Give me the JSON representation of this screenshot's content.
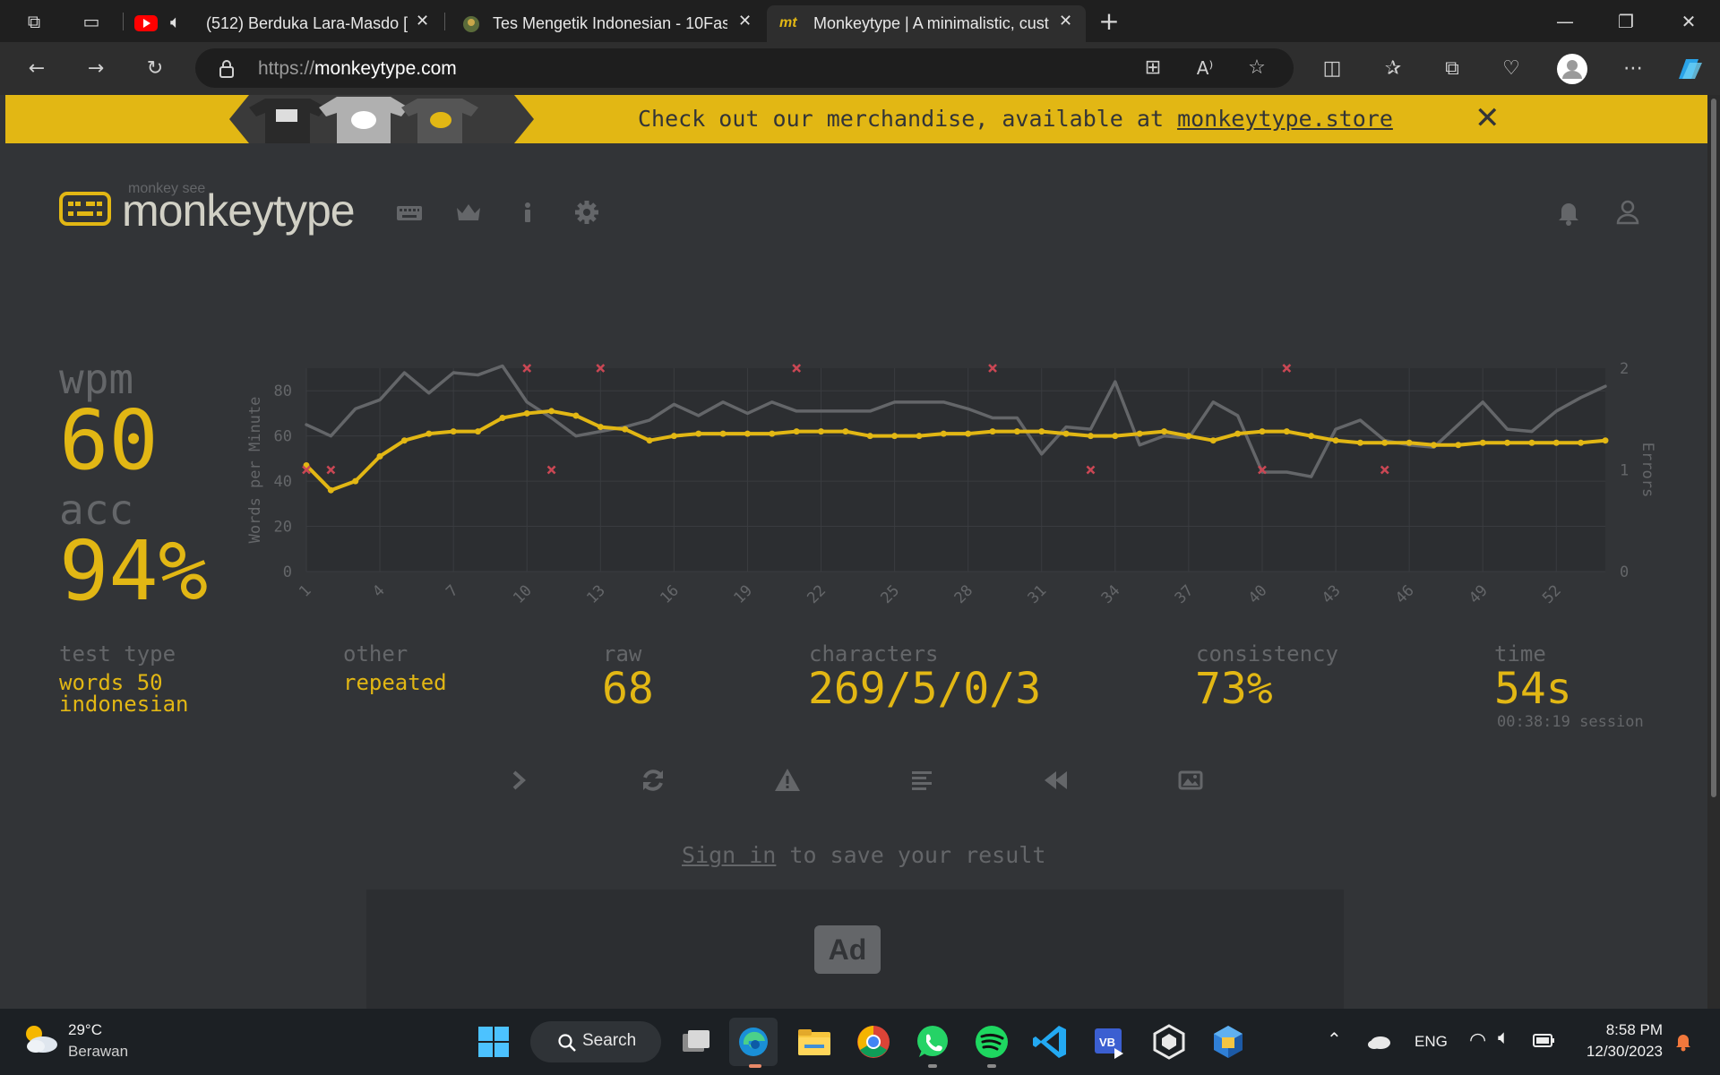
{
  "browser": {
    "tabs": [
      {
        "title": "(512) Berduka Lara-Masdo [",
        "close": "✕"
      },
      {
        "title": "Tes Mengetik Indonesian - 10Fast",
        "close": "✕"
      },
      {
        "title": "Monkeytype | A minimalistic, cust",
        "close": "✕"
      }
    ],
    "active_tab_favicon": "mt",
    "new_tab": "+",
    "window_controls": {
      "minimize": "—",
      "restore": "❐",
      "close": "✕"
    },
    "url_prefix": "https://",
    "url_domain": "monkeytype.com"
  },
  "banner": {
    "text": "Check out our merchandise, available at ",
    "link": "monkeytype.store",
    "close": "✕"
  },
  "nav": {
    "logo_top": "monkey see",
    "logo_text": "monkeytype",
    "icons": [
      "keyboard-icon",
      "crown-icon",
      "info-icon",
      "gear-icon",
      "bell-icon",
      "user-icon"
    ]
  },
  "result": {
    "wpm_label": "wpm",
    "wpm": "60",
    "acc_label": "acc",
    "acc": "94%",
    "test_type_label": "test type",
    "test_type_line1": "words 50",
    "test_type_line2": "indonesian",
    "other_label": "other",
    "other_value": "repeated",
    "raw_label": "raw",
    "raw_value": "68",
    "characters_label": "characters",
    "characters_value": "269/5/0/3",
    "consistency_label": "consistency",
    "consistency_value": "73%",
    "time_label": "time",
    "time_value": "54s",
    "session": "00:38:19 session"
  },
  "chart_data": {
    "type": "line",
    "ylabel": "Words per Minute",
    "y2label": "Errors",
    "ylim": [
      0,
      90
    ],
    "y2lim": [
      0,
      2
    ],
    "yticks": [
      "0",
      "20",
      "40",
      "60",
      "80"
    ],
    "y2ticks": [
      "0",
      "1",
      "2"
    ],
    "xticks": [
      "1",
      "4",
      "7",
      "10",
      "13",
      "16",
      "19",
      "22",
      "25",
      "28",
      "31",
      "34",
      "37",
      "40",
      "43",
      "46",
      "49",
      "52"
    ],
    "x": [
      1,
      2,
      3,
      4,
      5,
      6,
      7,
      8,
      9,
      10,
      11,
      12,
      13,
      14,
      15,
      16,
      17,
      18,
      19,
      20,
      21,
      22,
      23,
      24,
      25,
      26,
      27,
      28,
      29,
      30,
      31,
      32,
      33,
      34,
      35,
      36,
      37,
      38,
      39,
      40,
      41,
      42,
      43,
      44,
      45,
      46,
      47,
      48,
      49,
      50,
      51,
      52,
      53,
      54
    ],
    "series": [
      {
        "name": "raw",
        "color": "#646669",
        "values": [
          65,
          60,
          72,
          76,
          88,
          79,
          88,
          87,
          91,
          75,
          68,
          60,
          62,
          64,
          67,
          74,
          69,
          75,
          70,
          75,
          71,
          71,
          71,
          71,
          75,
          75,
          75,
          72,
          68,
          68,
          52,
          64,
          63,
          84,
          56,
          60,
          59,
          75,
          69,
          44,
          44,
          42,
          63,
          67,
          58,
          56,
          55,
          65,
          75,
          63,
          62,
          71,
          77,
          82,
          73
        ]
      },
      {
        "name": "wpm",
        "color": "#e2b714",
        "values": [
          47,
          36,
          40,
          51,
          58,
          61,
          62,
          62,
          68,
          70,
          71,
          69,
          64,
          63,
          58,
          60,
          61,
          61,
          61,
          61,
          62,
          62,
          62,
          60,
          60,
          60,
          61,
          61,
          62,
          62,
          62,
          61,
          60,
          60,
          61,
          62,
          60,
          58,
          61,
          62,
          62,
          60,
          58,
          57,
          57,
          57,
          56,
          56,
          57,
          57,
          57,
          57,
          57,
          58,
          58,
          59
        ]
      }
    ],
    "errors": [
      {
        "x": 1,
        "y": 1
      },
      {
        "x": 2,
        "y": 1
      },
      {
        "x": 10,
        "y": 2
      },
      {
        "x": 11,
        "y": 1
      },
      {
        "x": 13,
        "y": 2
      },
      {
        "x": 21,
        "y": 2
      },
      {
        "x": 29,
        "y": 2
      },
      {
        "x": 33,
        "y": 1
      },
      {
        "x": 40,
        "y": 1
      },
      {
        "x": 41,
        "y": 2
      },
      {
        "x": 45,
        "y": 1
      }
    ]
  },
  "actions": {
    "icons": [
      "next-test-icon",
      "restart-test-icon",
      "report-icon",
      "word-history-icon",
      "replay-icon",
      "screenshot-icon"
    ]
  },
  "signin": {
    "link": "Sign in",
    "rest": " to save your result"
  },
  "ad": {
    "label": "Ad"
  },
  "taskbar": {
    "weather_temp": "29°C",
    "weather_desc": "Berawan",
    "search_label": "Search",
    "lang": "ENG",
    "time": "8:58 PM",
    "date": "12/30/2023"
  },
  "colors": {
    "background": "#323437",
    "accent": "#e2b714",
    "sub": "#646669",
    "text": "#d1d0c5",
    "error": "#ca4754"
  }
}
